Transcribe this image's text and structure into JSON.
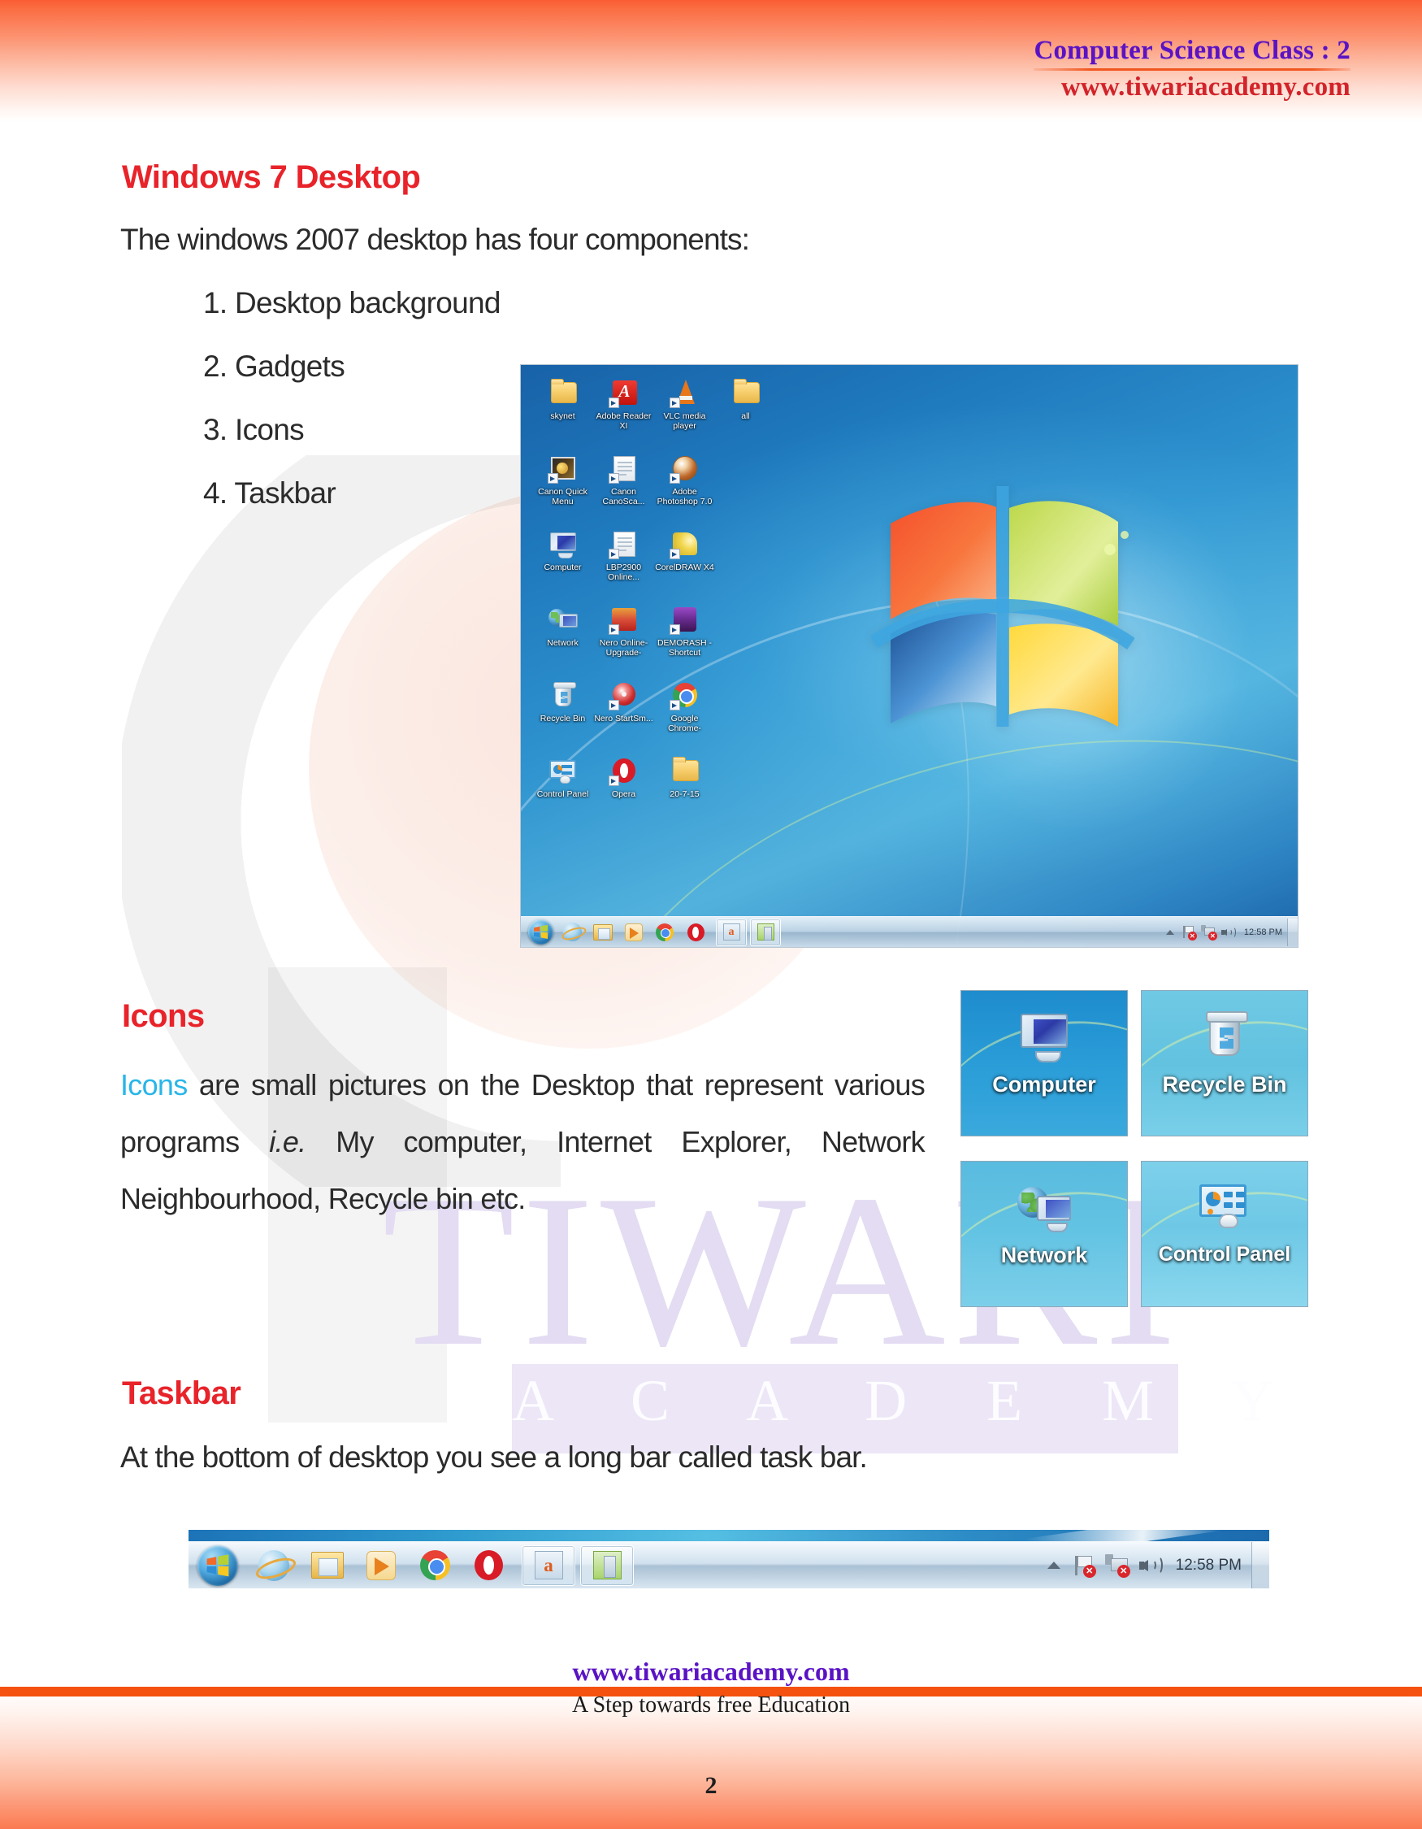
{
  "header": {
    "title": "Computer Science Class : 2",
    "url": "www.tiwariacademy.com"
  },
  "sections": {
    "desktop": {
      "heading": "Windows 7 Desktop",
      "intro": "The windows 2007 desktop has four components:",
      "components": [
        "1. Desktop background",
        "2. Gadgets",
        "3. Icons",
        "4. Taskbar"
      ]
    },
    "icons": {
      "heading": "Icons",
      "paragraph_keyword": "Icons",
      "paragraph_rest_1": " are small pictures on the Desktop that represent various programs ",
      "paragraph_italic": "i.e.",
      "paragraph_rest_2": " My computer, Internet Explorer, Network Neighbourhood, Recycle bin etc."
    },
    "taskbar": {
      "heading": "Taskbar",
      "paragraph": "At the bottom of desktop you see a long bar called task bar."
    }
  },
  "desktop_screenshot": {
    "icons": [
      [
        {
          "label": "skynet",
          "glyph": "folder-icon",
          "shortcut": false
        },
        {
          "label": "Adobe Reader XI",
          "glyph": "pdf-icon",
          "shortcut": true
        },
        {
          "label": "VLC media player",
          "glyph": "vlc-cone-icon",
          "shortcut": true
        },
        {
          "label": "all",
          "glyph": "folder-icon",
          "shortcut": false
        }
      ],
      [
        {
          "label": "Canon Quick Menu",
          "glyph": "photo-frame-icon",
          "shortcut": true
        },
        {
          "label": "Canon CanoSca...",
          "glyph": "document-help-icon",
          "shortcut": true
        },
        {
          "label": "Adobe Photoshop 7.0",
          "glyph": "photoshop-icon",
          "shortcut": true
        },
        null
      ],
      [
        {
          "label": "Computer",
          "glyph": "monitor-icon",
          "shortcut": false
        },
        {
          "label": "LBP2900 Online...",
          "glyph": "document-icon",
          "shortcut": true
        },
        {
          "label": "CorelDRAW X4",
          "glyph": "coreldraw-icon",
          "shortcut": true
        },
        null
      ],
      [
        {
          "label": "Network",
          "glyph": "globe-monitor-icon",
          "shortcut": false
        },
        {
          "label": "Nero Online-Upgrade-",
          "glyph": "nero-box-icon",
          "shortcut": true
        },
        {
          "label": "DEMORASH -Shortcut",
          "glyph": "demorash-icon",
          "shortcut": true
        },
        null
      ],
      [
        {
          "label": "Recycle Bin",
          "glyph": "recycle-bin-icon",
          "shortcut": false
        },
        {
          "label": "Nero StartSm...",
          "glyph": "nero-disc-icon",
          "shortcut": true
        },
        {
          "label": "Google Chrome-",
          "glyph": "chrome-icon",
          "shortcut": true
        },
        null
      ],
      [
        {
          "label": "Control Panel",
          "glyph": "control-panel-icon",
          "shortcut": false
        },
        {
          "label": "Opera",
          "glyph": "opera-icon",
          "shortcut": true
        },
        {
          "label": "20-7-15",
          "glyph": "folder-icon",
          "shortcut": false
        },
        null
      ]
    ],
    "taskbar": {
      "start_button": "start-orb-icon",
      "pinned": [
        "internet-explorer-icon",
        "windows-explorer-icon",
        "media-player-icon",
        "google-chrome-icon",
        "opera-icon"
      ],
      "open_windows": [
        "word-document-icon",
        "excel-document-icon"
      ],
      "tray": [
        "show-hidden-icons-arrow",
        "action-center-flag-icon",
        "network-icon",
        "volume-icon"
      ],
      "clock": "12:58 PM"
    }
  },
  "icon_tiles": [
    {
      "label": "Computer",
      "glyph": "monitor-icon"
    },
    {
      "label": "Recycle Bin",
      "glyph": "recycle-bin-icon"
    },
    {
      "label": "Network",
      "glyph": "globe-monitor-icon"
    },
    {
      "label": "Control Panel",
      "glyph": "control-panel-icon"
    }
  ],
  "taskbar_screenshot": {
    "start_button": "start-orb-icon",
    "pinned": [
      "internet-explorer-icon",
      "windows-explorer-icon",
      "media-player-icon",
      "google-chrome-icon",
      "opera-icon"
    ],
    "open_windows": [
      "word-document-icon",
      "excel-document-icon"
    ],
    "tray": [
      "show-hidden-icons-arrow",
      "action-center-flag-icon",
      "network-icon",
      "volume-icon"
    ],
    "clock": "12:58 PM"
  },
  "footer": {
    "url": "www.tiwariacademy.com",
    "tagline": "A Step towards free Education",
    "page_number": "2"
  },
  "watermark": {
    "line1": "TIWARI",
    "line2": "A C A D E M Y"
  },
  "colors": {
    "heading_red": "#e8232a",
    "header_purple": "#5a13c4",
    "header_red": "#d2232a",
    "keyword_cyan": "#29b6e8",
    "banner_orange": "#fa5c33",
    "body_text": "#2b2b2b"
  }
}
